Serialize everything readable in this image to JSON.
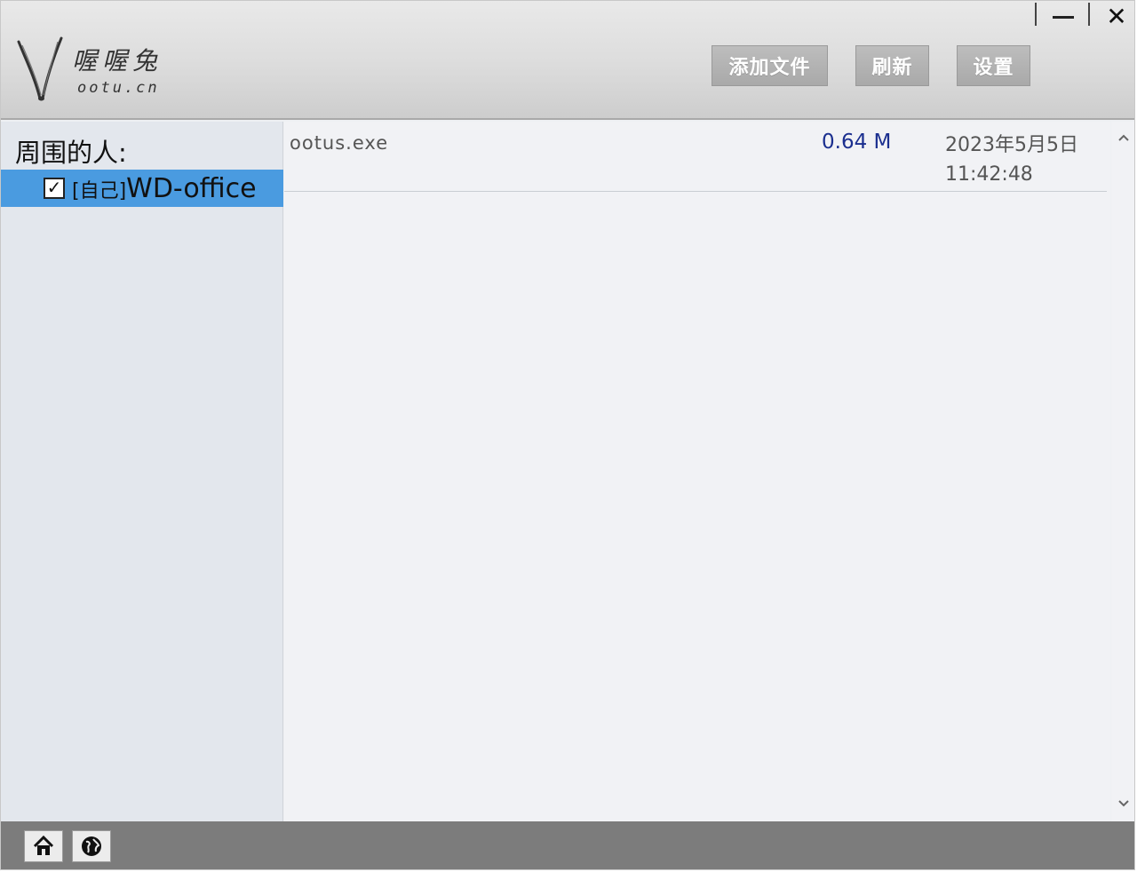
{
  "app": {
    "logo_cn": "喔喔兔",
    "logo_en": "ootu.cn"
  },
  "toolbar": {
    "add_file_label": "添加文件",
    "refresh_label": "刷新",
    "settings_label": "设置"
  },
  "window_controls": {
    "close_glyph": "✕"
  },
  "sidebar": {
    "title": "周围的人:",
    "peers": [
      {
        "tag": "[自己]",
        "name": "WD-office",
        "checked": true,
        "check_glyph": "✓"
      }
    ]
  },
  "files": [
    {
      "name": "ootus.exe",
      "size": "0.64 M",
      "date": "2023年5月5日",
      "time": "11:42:48"
    }
  ],
  "bottom_bar": {
    "icons": [
      "home-icon",
      "globe-icon"
    ]
  },
  "colors": {
    "selection": "#4a9be0",
    "size_text": "#1b2f8f",
    "toolbar_button": "#b3b3b3",
    "bottom_bar": "#7c7c7c"
  }
}
